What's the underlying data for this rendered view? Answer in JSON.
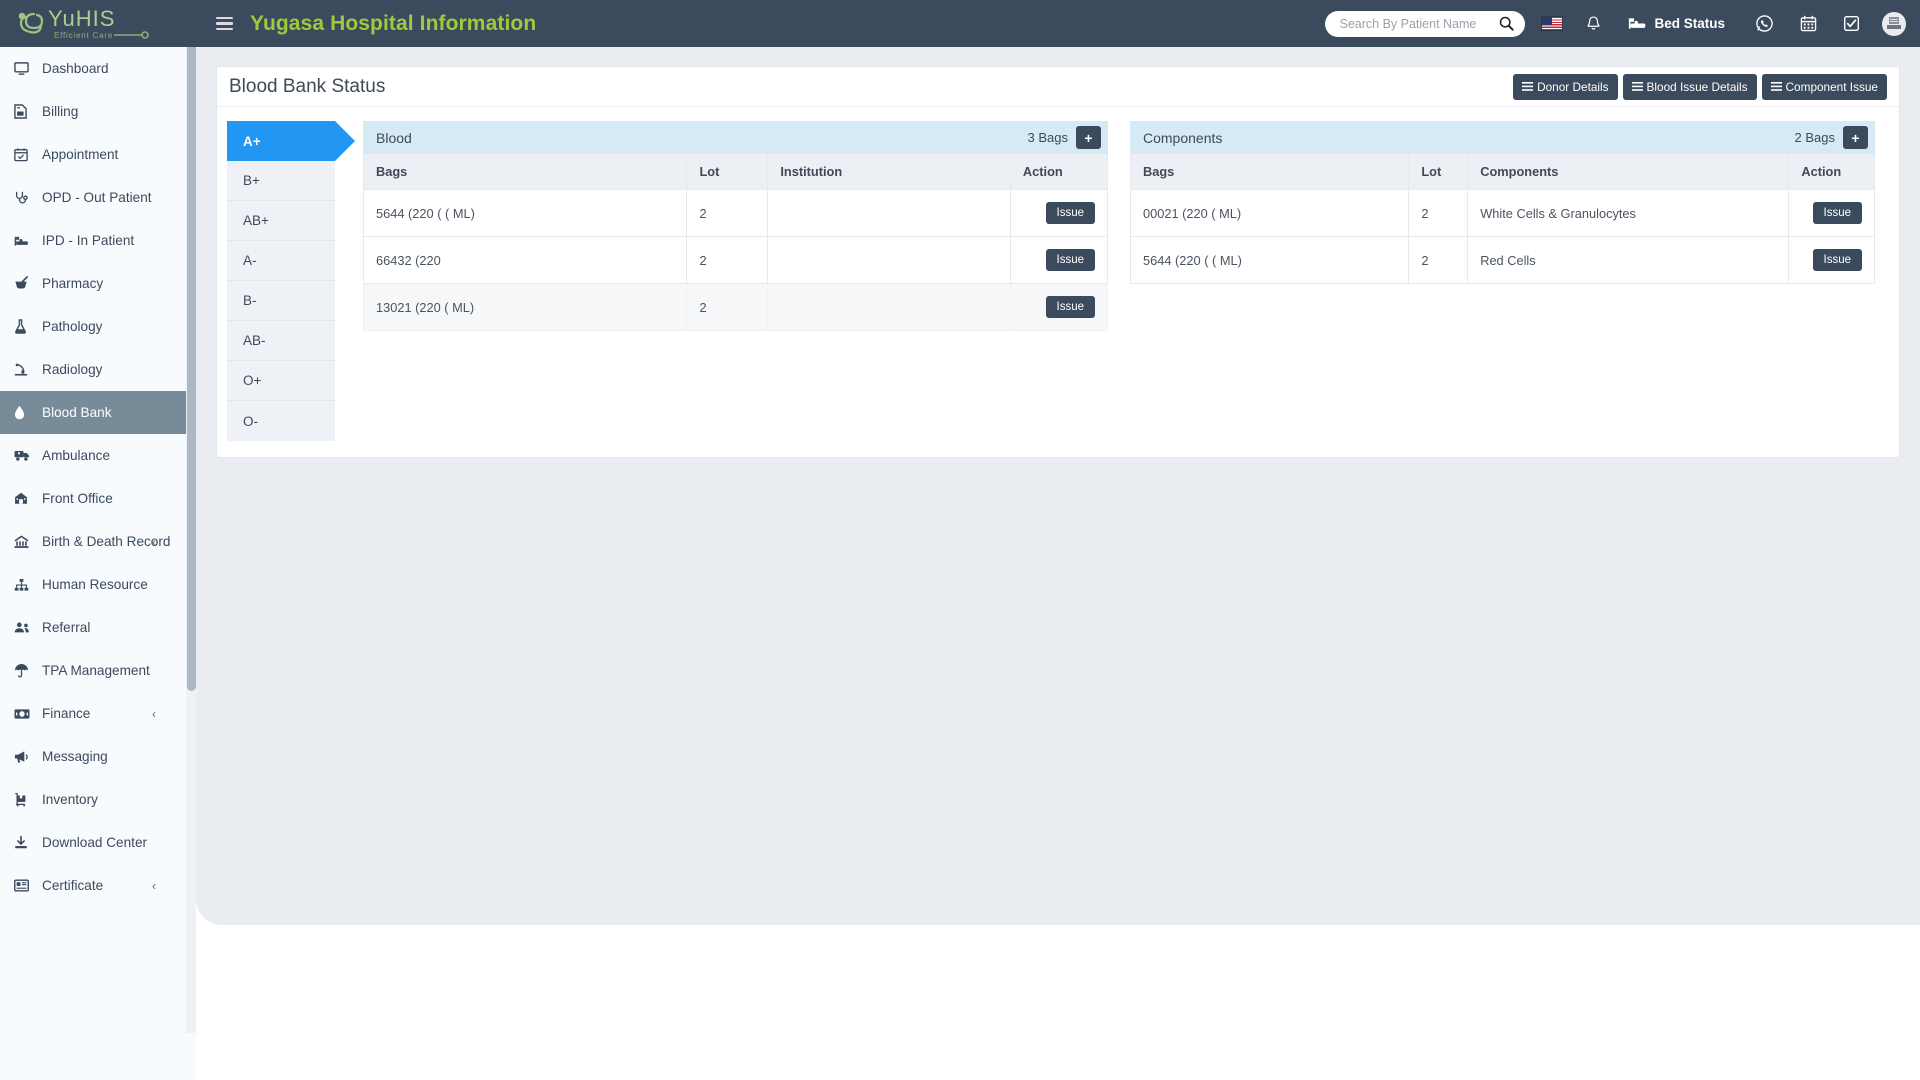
{
  "brand": {
    "logo_text": "YuHIS",
    "logo_tagline": "Efficient Care"
  },
  "topbar": {
    "app_title": "Yugasa Hospital Information",
    "menu_icon": "hamburger-icon",
    "search": {
      "placeholder": "Search By Patient Name",
      "value": "",
      "icon": "search-icon"
    },
    "language_flag": "us-flag-icon",
    "notification_icon": "bell-icon",
    "bed_status_label": "Bed Status",
    "bed_status_icon": "bed-icon",
    "whatsapp_icon": "whatsapp-icon",
    "calendar_icon": "calendar-icon",
    "tasks_icon": "check-square-icon",
    "avatar": "user-avatar"
  },
  "sidebar": {
    "items": [
      {
        "label": "Dashboard",
        "icon": "monitor-icon",
        "active": false,
        "caret": ""
      },
      {
        "label": "Billing",
        "icon": "file-invoice-icon",
        "active": false,
        "caret": ""
      },
      {
        "label": "Appointment",
        "icon": "calendar-check-icon",
        "active": false,
        "caret": ""
      },
      {
        "label": "OPD - Out Patient",
        "icon": "stethoscope-icon",
        "active": false,
        "caret": ""
      },
      {
        "label": "IPD - In Patient",
        "icon": "hospital-bed-icon",
        "active": false,
        "caret": ""
      },
      {
        "label": "Pharmacy",
        "icon": "mortar-pestle-icon",
        "active": false,
        "caret": ""
      },
      {
        "label": "Pathology",
        "icon": "flask-icon",
        "active": false,
        "caret": ""
      },
      {
        "label": "Radiology",
        "icon": "xray-icon",
        "active": false,
        "caret": ""
      },
      {
        "label": "Blood Bank",
        "icon": "blood-drop-icon",
        "active": true,
        "caret": ""
      },
      {
        "label": "Ambulance",
        "icon": "ambulance-icon",
        "active": false,
        "caret": ""
      },
      {
        "label": "Front Office",
        "icon": "building-icon",
        "active": false,
        "caret": ""
      },
      {
        "label": "Birth & Death Record",
        "icon": "monument-icon",
        "active": false,
        "caret": "‹"
      },
      {
        "label": "Human Resource",
        "icon": "sitemap-icon",
        "active": false,
        "caret": ""
      },
      {
        "label": "Referral",
        "icon": "users-icon",
        "active": false,
        "caret": ""
      },
      {
        "label": "TPA Management",
        "icon": "umbrella-icon",
        "active": false,
        "caret": ""
      },
      {
        "label": "Finance",
        "icon": "money-icon",
        "active": false,
        "caret": "‹"
      },
      {
        "label": "Messaging",
        "icon": "bullhorn-icon",
        "active": false,
        "caret": ""
      },
      {
        "label": "Inventory",
        "icon": "inventory-icon",
        "active": false,
        "caret": ""
      },
      {
        "label": "Download Center",
        "icon": "download-icon",
        "active": false,
        "caret": ""
      },
      {
        "label": "Certificate",
        "icon": "certificate-icon",
        "active": false,
        "caret": "‹"
      }
    ]
  },
  "page": {
    "title": "Blood Bank Status",
    "header_buttons": [
      {
        "label": "Donor Details",
        "icon": "bars-icon"
      },
      {
        "label": "Blood Issue Details",
        "icon": "bars-icon"
      },
      {
        "label": "Component Issue",
        "icon": "bars-icon"
      }
    ]
  },
  "blood_types": [
    {
      "label": "A+",
      "active": true
    },
    {
      "label": "B+",
      "active": false
    },
    {
      "label": "AB+",
      "active": false
    },
    {
      "label": "A-",
      "active": false
    },
    {
      "label": "B-",
      "active": false
    },
    {
      "label": "AB-",
      "active": false
    },
    {
      "label": "O+",
      "active": false
    },
    {
      "label": "O-",
      "active": false
    }
  ],
  "blood_panel": {
    "title": "Blood",
    "count_label": "3 Bags",
    "add_label": "+",
    "columns": [
      "Bags",
      "Lot",
      "Institution",
      "Action"
    ],
    "rows": [
      {
        "bags": "5644 (220 ( ( ML)",
        "lot": "2",
        "institution": "",
        "action": "Issue"
      },
      {
        "bags": "66432 (220",
        "lot": "2",
        "institution": "",
        "action": "Issue"
      },
      {
        "bags": "13021 (220 ( ML)",
        "lot": "2",
        "institution": "",
        "action": "Issue"
      }
    ]
  },
  "components_panel": {
    "title": "Components",
    "count_label": "2 Bags",
    "add_label": "+",
    "columns": [
      "Bags",
      "Lot",
      "Components",
      "Action"
    ],
    "rows": [
      {
        "bags": "00021 (220 ( ML)",
        "lot": "2",
        "components": "White Cells & Granulocytes",
        "action": "Issue"
      },
      {
        "bags": "5644 (220 ( ( ML)",
        "lot": "2",
        "components": "Red Cells",
        "action": "Issue"
      }
    ]
  },
  "colors": {
    "navbar": "#3c4a5e",
    "brand_green": "#9ccb3b",
    "active_blood_type": "#2196f3",
    "panel_header": "#d6eaf5",
    "sidebar_active": "#788b98",
    "content_bg": "#e9edf2"
  }
}
